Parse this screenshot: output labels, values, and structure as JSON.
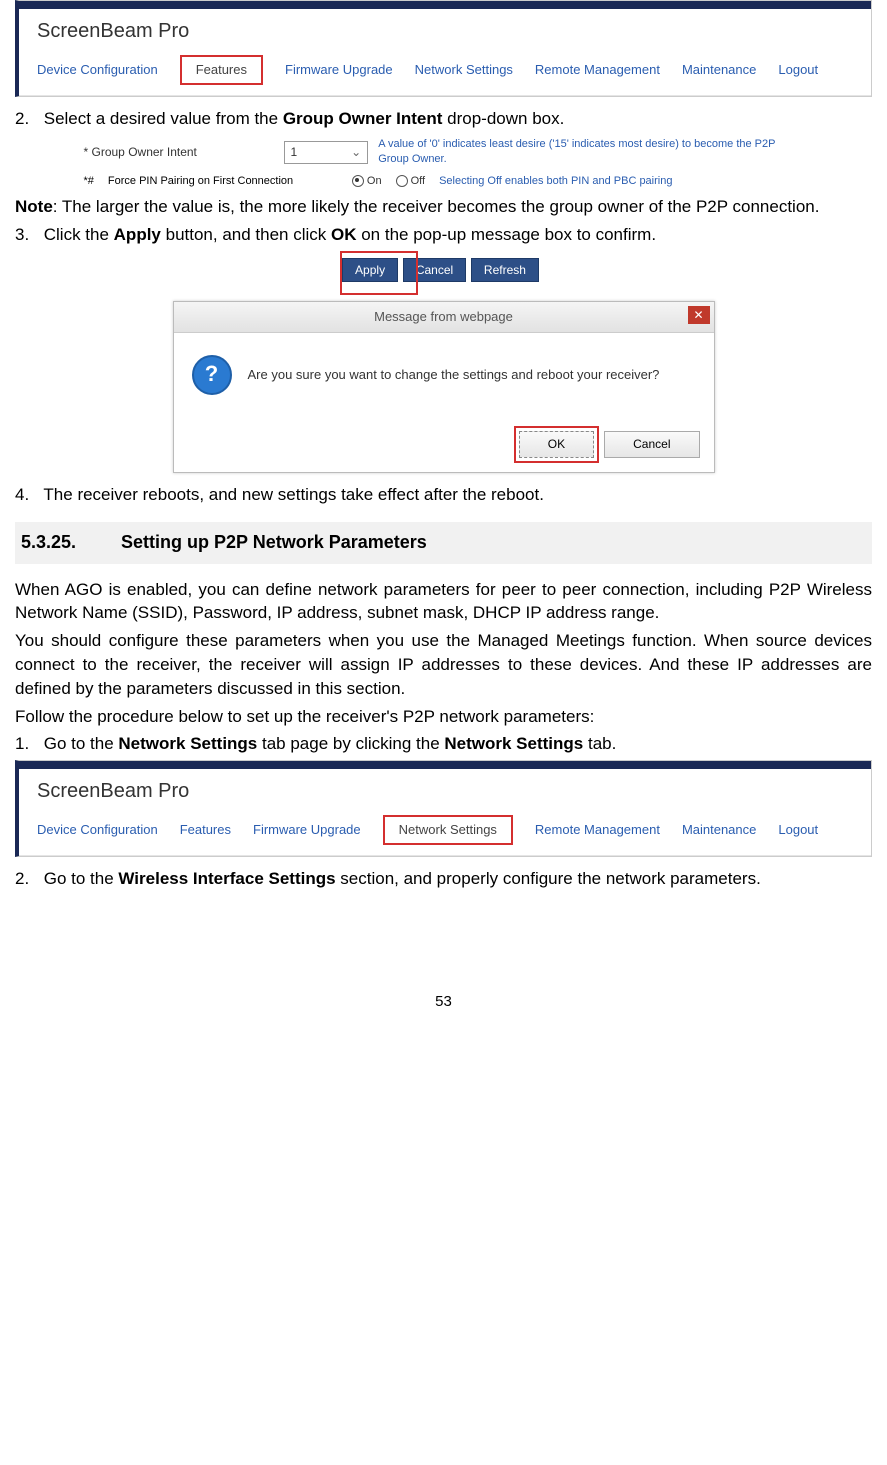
{
  "nav1": {
    "brand": "ScreenBeam Pro",
    "tabs": [
      "Device Configuration",
      "Features",
      "Firmware Upgrade",
      "Network Settings",
      "Remote Management",
      "Maintenance",
      "Logout"
    ],
    "active": "Features"
  },
  "nav2": {
    "brand": "ScreenBeam Pro",
    "tabs": [
      "Device Configuration",
      "Features",
      "Firmware Upgrade",
      "Network Settings",
      "Remote Management",
      "Maintenance",
      "Logout"
    ],
    "active": "Network Settings"
  },
  "step2": {
    "pre": "Select a desired value from the ",
    "bold": "Group Owner Intent",
    "post": " drop-down box."
  },
  "go_fig": {
    "label": "* Group Owner Intent",
    "value": "1",
    "hint": "A value of '0' indicates least desire ('15' indicates most desire) to become the P2P Group Owner.",
    "pin_label_pre": "*# ",
    "pin_label": "Force PIN Pairing on First Connection",
    "on": "On",
    "off": "Off",
    "off_hint": "Selecting Off enables both PIN and PBC pairing"
  },
  "note": {
    "label": "Note",
    "text": ": The larger the value is, the more likely the receiver becomes the group owner of the P2P connection."
  },
  "step3": {
    "pre": "Click the ",
    "b1": "Apply",
    "mid": " button, and then click ",
    "b2": "OK",
    "post": " on the pop-up message box to confirm."
  },
  "buttons": {
    "apply": "Apply",
    "cancel": "Cancel",
    "refresh": "Refresh"
  },
  "dialog": {
    "title": "Message from webpage",
    "msg": "Are you sure you want to change the settings and reboot your receiver?",
    "ok": "OK",
    "cancel": "Cancel"
  },
  "step4": "The receiver reboots, and new settings take effect after the reboot.",
  "section": {
    "num": "5.3.25.",
    "title": "Setting up P2P Network Parameters"
  },
  "p1": "When AGO is enabled, you can define network parameters for peer to peer connection, including P2P Wireless Network Name (SSID), Password, IP address, subnet mask, DHCP IP address range.",
  "p2": "You should configure these parameters when you use the Managed Meetings function. When source devices connect to the receiver, the receiver will assign IP addresses to these devices. And these IP addresses are defined by the parameters discussed in this section.",
  "p3": "Follow the procedure below to set up the receiver's P2P network parameters:",
  "step_ns1": {
    "pre": "Go to the ",
    "b1": "Network Settings",
    "mid": " tab page by clicking the ",
    "b2": "Network Settings",
    "post": " tab."
  },
  "step_ns2": {
    "pre": "Go to the ",
    "b1": "Wireless Interface Settings",
    "post": " section, and properly configure the network parameters."
  },
  "page": "53"
}
